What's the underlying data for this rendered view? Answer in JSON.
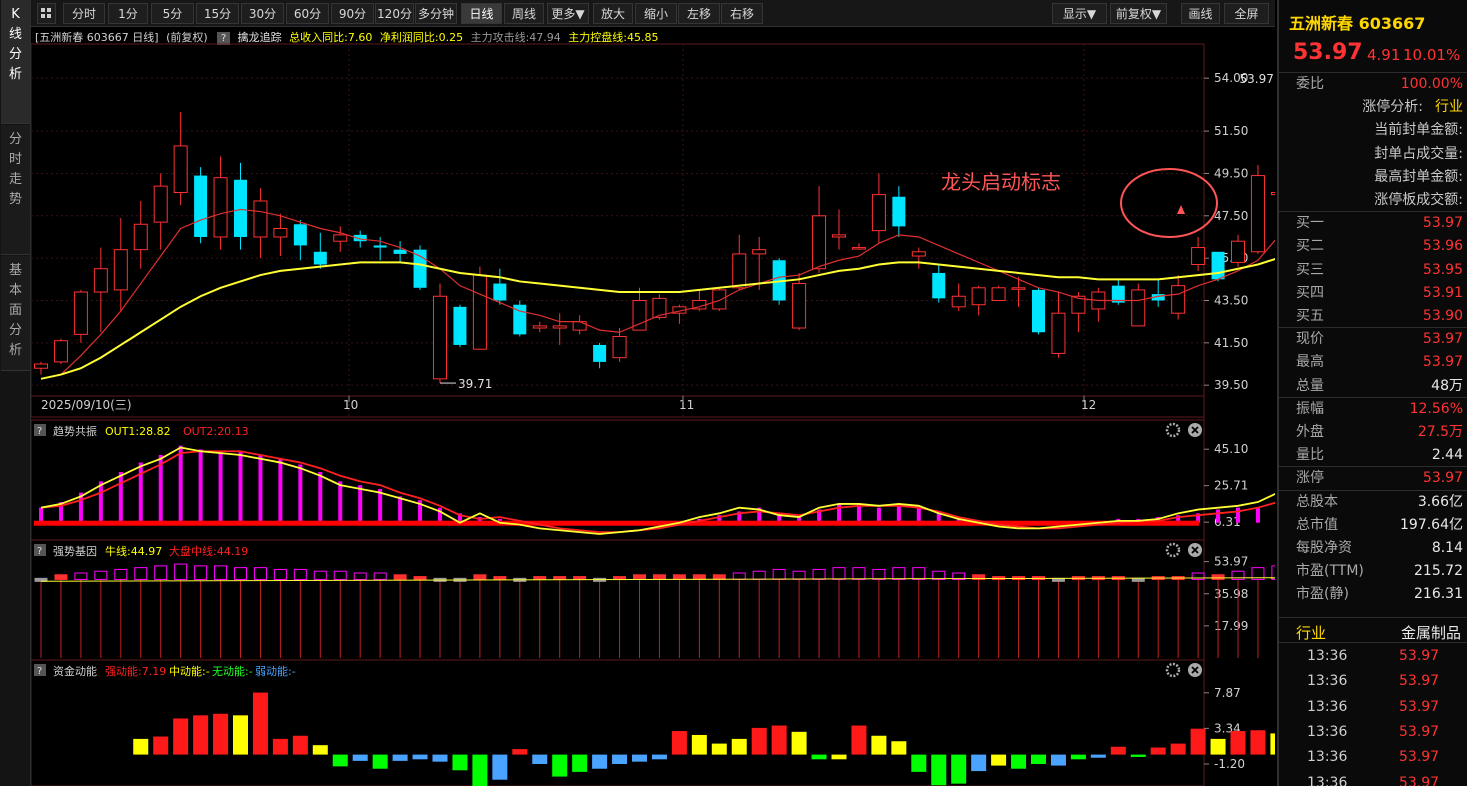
{
  "sidebar": {
    "tabs": [
      {
        "label": [
          "K",
          "线",
          "分",
          "析"
        ]
      },
      {
        "label": [
          "分",
          "时",
          "走",
          "势"
        ]
      },
      {
        "label": [
          "基",
          "本",
          "面",
          "分",
          "析"
        ]
      }
    ]
  },
  "toolbar": {
    "periods": [
      "分时",
      "1分",
      "5分",
      "15分",
      "30分",
      "60分",
      "90分",
      "120分",
      "多分钟",
      "日线",
      "周线",
      "更多▼"
    ],
    "selected": "日线",
    "actions": [
      "放大",
      "缩小",
      "左移",
      "右移"
    ],
    "right": [
      "显示▼",
      "前复权▼",
      "画线",
      "全屏"
    ]
  },
  "main_chart": {
    "header": {
      "stock": "[五洲新春 603667 日线]",
      "adjust": "(前复权)",
      "indicator": "擒龙追踪",
      "v1": "总收入同比:7.60",
      "v2": "净利润同比:0.25",
      "v3": "主力攻击线:47.94",
      "v4": "主力控盘线:45.85"
    },
    "annotation": "龙头启动标志",
    "high_label": "53.97",
    "low_label": "39.71",
    "date_labels": [
      "2025/09/10(三)",
      "10",
      "11",
      "12"
    ]
  },
  "chart_data": [
    {
      "type": "candlestick",
      "title": "[五洲新春 603667 日线]",
      "ylim": [
        38.8,
        55.0
      ],
      "yticks": [
        "54.00",
        "51.50",
        "49.50",
        "47.50",
        "45.50",
        "43.50",
        "41.50",
        "39.50"
      ],
      "candles": [
        [
          40.3,
          40.5,
          40.0,
          40.6
        ],
        [
          40.6,
          41.6,
          40.5,
          41.7
        ],
        [
          41.9,
          43.9,
          41.5,
          44.0
        ],
        [
          43.9,
          45.0,
          42.0,
          46.0
        ],
        [
          44.0,
          45.9,
          43.0,
          47.4
        ],
        [
          45.9,
          47.1,
          45.0,
          48.2
        ],
        [
          47.2,
          48.9,
          45.9,
          49.5
        ],
        [
          48.6,
          50.8,
          48.0,
          52.4
        ],
        [
          49.4,
          46.5,
          46.2,
          49.8
        ],
        [
          46.5,
          49.3,
          45.9,
          50.3
        ],
        [
          49.2,
          46.5,
          45.9,
          50.0
        ],
        [
          46.5,
          48.2,
          45.5,
          48.8
        ],
        [
          46.5,
          46.9,
          45.6,
          47.6
        ],
        [
          47.1,
          46.1,
          45.4,
          47.3
        ],
        [
          45.8,
          45.2,
          45.0,
          46.7
        ],
        [
          46.3,
          46.6,
          45.8,
          47.0
        ],
        [
          46.6,
          46.3,
          46.0,
          46.8
        ],
        [
          46.1,
          46.0,
          45.4,
          46.5
        ],
        [
          45.9,
          45.7,
          45.3,
          46.3
        ],
        [
          45.9,
          44.1,
          44.0,
          46.1
        ],
        [
          39.8,
          43.7,
          39.6,
          44.3
        ],
        [
          43.2,
          41.4,
          41.3,
          43.3
        ],
        [
          41.2,
          44.7,
          41.2,
          45.1
        ],
        [
          44.3,
          43.5,
          43.3,
          45.0
        ],
        [
          43.3,
          41.9,
          41.8,
          43.5
        ],
        [
          42.2,
          42.3,
          42.0,
          42.5
        ],
        [
          42.2,
          42.3,
          41.4,
          42.9
        ],
        [
          42.1,
          42.5,
          41.9,
          42.8
        ],
        [
          41.4,
          40.6,
          40.3,
          41.5
        ],
        [
          40.8,
          41.8,
          40.6,
          42.2
        ],
        [
          42.1,
          43.5,
          42.1,
          44.1
        ],
        [
          42.7,
          43.6,
          42.6,
          43.8
        ],
        [
          42.9,
          43.2,
          42.4,
          43.3
        ],
        [
          43.1,
          43.5,
          43.0,
          44.0
        ],
        [
          43.1,
          44.0,
          43.0,
          44.1
        ],
        [
          44.1,
          45.7,
          44.0,
          46.6
        ],
        [
          45.7,
          45.9,
          44.0,
          46.5
        ],
        [
          45.4,
          43.5,
          43.3,
          45.5
        ],
        [
          42.2,
          44.3,
          42.1,
          44.8
        ],
        [
          45.0,
          47.5,
          44.8,
          48.9
        ],
        [
          46.5,
          46.6,
          45.9,
          47.8
        ],
        [
          46.0,
          46.0,
          45.9,
          46.2
        ],
        [
          46.8,
          48.5,
          46.2,
          49.5
        ],
        [
          48.4,
          47.0,
          46.5,
          48.9
        ],
        [
          45.6,
          45.8,
          45.0,
          46.0
        ],
        [
          44.8,
          43.6,
          43.4,
          45.2
        ],
        [
          43.2,
          43.7,
          43.0,
          44.3
        ],
        [
          43.3,
          44.1,
          42.8,
          44.2
        ],
        [
          43.5,
          44.1,
          43.5,
          44.2
        ],
        [
          44.1,
          44.1,
          43.2,
          44.6
        ],
        [
          44.0,
          42.0,
          41.9,
          44.1
        ],
        [
          41.0,
          42.9,
          40.8,
          43.9
        ],
        [
          42.9,
          43.7,
          42.0,
          43.9
        ],
        [
          43.1,
          43.9,
          42.5,
          44.1
        ],
        [
          44.2,
          43.4,
          43.3,
          44.5
        ],
        [
          42.3,
          44.0,
          42.3,
          44.3
        ],
        [
          43.8,
          43.5,
          43.2,
          44.5
        ],
        [
          42.9,
          44.2,
          42.6,
          44.7
        ],
        [
          45.2,
          46.0,
          44.9,
          46.5
        ],
        [
          45.8,
          44.5,
          44.4,
          45.8
        ],
        [
          45.3,
          46.3,
          45.1,
          46.6
        ],
        [
          45.8,
          49.4,
          45.7,
          49.9
        ],
        [
          48.5,
          48.6,
          45.0,
          50.5
        ],
        [
          48.4,
          53.97,
          48.0,
          53.97
        ]
      ],
      "series": [
        {
          "name": "主力攻击线",
          "values": [
            39.8,
            40.0,
            40.9,
            41.9,
            43.0,
            44.3,
            45.6,
            46.9,
            47.3,
            47.6,
            47.8,
            47.7,
            47.5,
            47.2,
            46.9,
            46.7,
            46.4,
            46.3,
            46.0,
            45.6,
            45.0,
            44.2,
            43.8,
            43.4,
            43.0,
            42.8,
            42.5,
            42.5,
            42.1,
            42.0,
            42.4,
            42.8,
            43.0,
            43.2,
            43.5,
            44.0,
            44.3,
            44.6,
            44.7,
            45.1,
            45.4,
            45.6,
            46.2,
            46.6,
            46.5,
            46.1,
            45.7,
            45.3,
            44.9,
            44.5,
            44.1,
            43.9,
            43.6,
            43.5,
            43.5,
            43.5,
            43.7,
            43.8,
            44.2,
            44.5,
            44.9,
            45.4,
            46.5,
            47.94
          ]
        },
        {
          "name": "主力控盘线",
          "values": [
            39.8,
            40.0,
            40.3,
            40.8,
            41.4,
            42.0,
            42.6,
            43.2,
            43.7,
            44.1,
            44.4,
            44.7,
            44.9,
            45.0,
            45.1,
            45.2,
            45.3,
            45.3,
            45.3,
            45.2,
            45.0,
            44.8,
            44.7,
            44.6,
            44.4,
            44.3,
            44.2,
            44.1,
            44.0,
            43.9,
            43.9,
            43.9,
            43.9,
            44.0,
            44.1,
            44.2,
            44.3,
            44.4,
            44.5,
            44.7,
            44.9,
            45.0,
            45.2,
            45.3,
            45.3,
            45.2,
            45.1,
            45.0,
            44.9,
            44.8,
            44.7,
            44.6,
            44.6,
            44.5,
            44.5,
            44.5,
            44.5,
            44.6,
            44.7,
            44.8,
            45.0,
            45.2,
            45.5,
            45.85
          ]
        }
      ]
    },
    {
      "type": "bar",
      "title": "趋势共振",
      "legend": [
        "OUT1:28.82",
        "OUT2:20.13"
      ],
      "yticks": [
        "45.10",
        "25.71",
        "6.31"
      ],
      "ylim": [
        0,
        50
      ],
      "values": [
        14,
        17,
        22,
        28,
        33,
        38,
        42,
        47,
        45,
        44,
        44,
        42,
        40,
        37,
        33,
        28,
        26,
        24,
        20,
        18,
        14,
        11,
        9,
        8,
        7,
        5,
        3,
        2,
        1,
        1,
        2,
        4,
        6,
        8,
        10,
        12,
        14,
        11,
        10,
        13,
        16,
        16,
        14,
        16,
        14,
        12,
        9,
        7,
        5,
        4,
        4,
        5,
        6,
        7,
        8,
        8,
        9,
        10,
        11,
        13,
        14,
        14,
        18,
        32
      ],
      "series": [
        {
          "name": "OUT1",
          "values": [
            14,
            16,
            20,
            26,
            31,
            36,
            40,
            46,
            44,
            43,
            42,
            40,
            38,
            35,
            31,
            26,
            24,
            22,
            19,
            16,
            12,
            6,
            11,
            6,
            5,
            3,
            2,
            1,
            0,
            1,
            2,
            4,
            6,
            9,
            11,
            14,
            13,
            10,
            9,
            14,
            16,
            16,
            15,
            16,
            15,
            11,
            8,
            6,
            4,
            3,
            3,
            4,
            5,
            6,
            7,
            7,
            8,
            11,
            13,
            14,
            15,
            17,
            22,
            28.82
          ]
        },
        {
          "name": "OUT2",
          "values": [
            14,
            15,
            18,
            22,
            27,
            32,
            37,
            43,
            44,
            44,
            44,
            42,
            40,
            38,
            35,
            31,
            28,
            26,
            22,
            19,
            15,
            10,
            8,
            9,
            7,
            5,
            3,
            2,
            1,
            1,
            2,
            3,
            5,
            7,
            9,
            11,
            12,
            11,
            10,
            12,
            14,
            15,
            15,
            15,
            14,
            12,
            9,
            7,
            5,
            4,
            3,
            3,
            4,
            5,
            6,
            7,
            7,
            9,
            10,
            11,
            12,
            14,
            17,
            20.13
          ]
        }
      ]
    },
    {
      "type": "bar",
      "title": "强势基因",
      "legend": [
        "牛线:44.97",
        "大盘中线:44.19"
      ],
      "yticks": [
        "53.97",
        "35.98",
        "17.99"
      ],
      "ylim": [
        0,
        56
      ],
      "values": [
        44,
        46,
        47,
        48,
        49,
        50,
        51,
        52,
        51,
        51,
        50,
        50,
        49,
        49,
        48,
        48,
        47,
        47,
        46,
        45,
        43,
        44,
        46,
        45,
        44,
        45,
        45,
        45,
        44,
        45,
        46,
        46,
        46,
        46,
        46,
        47,
        48,
        49,
        48,
        49,
        50,
        50,
        49,
        50,
        50,
        48,
        47,
        46,
        45,
        45,
        45,
        44,
        45,
        45,
        45,
        44,
        45,
        45,
        47,
        46,
        48,
        50,
        51,
        53.97
      ]
    },
    {
      "type": "bar",
      "title": "资金动能",
      "legend": [
        "强动能:7.19",
        "中动能:-",
        "无动能:-",
        "弱动能:-"
      ],
      "yticks": [
        "7.87",
        "3.34",
        "-1.20"
      ],
      "ylim": [
        -4,
        9.5
      ],
      "values": [
        2.0,
        2.3,
        4.6,
        5.0,
        5.2,
        5.0,
        7.9,
        2.0,
        2.4,
        1.2,
        -1.5,
        -0.8,
        -1.8,
        -0.8,
        -0.6,
        -0.9,
        -2.0,
        -4.2,
        -3.2,
        0.7,
        -1.2,
        -2.8,
        -2.2,
        -1.8,
        -1.2,
        -0.9,
        -0.6,
        3.0,
        2.5,
        1.4,
        2.0,
        3.4,
        3.7,
        2.9,
        -0.6,
        -0.6,
        3.7,
        2.4,
        1.7,
        -2.2,
        -3.9,
        -3.7,
        -2.1,
        -1.4,
        -1.8,
        -1.2,
        -1.4,
        -0.6,
        -0.4,
        1.0,
        -0.3,
        0.9,
        1.4,
        3.3,
        2.0,
        3.0,
        3.1,
        2.7,
        7.19
      ],
      "color_codes": [
        "y",
        "r",
        "r",
        "r",
        "r",
        "y",
        "r",
        "r",
        "r",
        "y",
        "g",
        "b",
        "g",
        "b",
        "b",
        "b",
        "g",
        "g",
        "b",
        "r",
        "b",
        "g",
        "g",
        "b",
        "b",
        "b",
        "b",
        "r",
        "y",
        "y",
        "y",
        "r",
        "r",
        "y",
        "g",
        "y",
        "r",
        "y",
        "y",
        "g",
        "g",
        "g",
        "b",
        "y",
        "g",
        "g",
        "b",
        "g",
        "b",
        "r",
        "g",
        "r",
        "r",
        "r",
        "y",
        "r",
        "r",
        "y",
        "r"
      ]
    }
  ],
  "panel_headers": [
    {
      "name": "趋势共振",
      "items": [
        {
          "t": "OUT1:28.82",
          "c": "#ffff00"
        },
        {
          "t": "OUT2:20.13",
          "c": "#ff2020"
        }
      ]
    },
    {
      "name": "强势基因",
      "items": [
        {
          "t": "牛线:44.97",
          "c": "#ffff00"
        },
        {
          "t": "大盘中线:44.19",
          "c": "#ff2020"
        }
      ]
    },
    {
      "name": "资金动能",
      "items": [
        {
          "t": "强动能:7.19",
          "c": "#ff2020"
        },
        {
          "t": "中动能:-",
          "c": "#ffff00"
        },
        {
          "t": "无动能:-",
          "c": "#22ff22"
        },
        {
          "t": "弱动能:-",
          "c": "#4aa3ff"
        }
      ]
    }
  ],
  "quote": {
    "name_code": "五洲新春 603667",
    "price": "53.97",
    "change": "4.91",
    "pct": "10.01%",
    "rows": [
      {
        "k": "委比",
        "v": "100.00%",
        "c": "red"
      },
      {
        "k": "涨停分析:",
        "v": "行业",
        "c": "yellow",
        "indent": true
      },
      {
        "k": "当前封单金额:",
        "v": "",
        "c": "white",
        "indent": true
      },
      {
        "k": "封单占成交量:",
        "v": "",
        "c": "white",
        "indent": true
      },
      {
        "k": "最高封单金额:",
        "v": "",
        "c": "white",
        "indent": true
      },
      {
        "k": "涨停板成交额:",
        "v": "",
        "c": "white",
        "indent": true
      },
      {
        "k": "买一",
        "v": "53.97",
        "c": "red"
      },
      {
        "k": "买二",
        "v": "53.96",
        "c": "red"
      },
      {
        "k": "买三",
        "v": "53.95",
        "c": "red"
      },
      {
        "k": "买四",
        "v": "53.91",
        "c": "red"
      },
      {
        "k": "买五",
        "v": "53.90",
        "c": "red"
      },
      {
        "k": "现价",
        "v": "53.97",
        "c": "red"
      },
      {
        "k": "最高",
        "v": "53.97",
        "c": "red"
      },
      {
        "k": "总量",
        "v": "48万",
        "c": "white"
      },
      {
        "k": "振幅",
        "v": "12.56%",
        "c": "red"
      },
      {
        "k": "外盘",
        "v": "27.5万",
        "c": "red"
      },
      {
        "k": "量比",
        "v": "2.44",
        "c": "white"
      },
      {
        "k": "涨停",
        "v": "53.97",
        "c": "red"
      },
      {
        "k": "总股本",
        "v": "3.66亿",
        "c": "white"
      },
      {
        "k": "总市值",
        "v": "197.64亿",
        "c": "white"
      },
      {
        "k": "每股净资",
        "v": "8.14",
        "c": "white"
      },
      {
        "k": "市盈(TTM)",
        "v": "215.72",
        "c": "white"
      },
      {
        "k": "市盈(静)",
        "v": "216.31",
        "c": "white"
      }
    ],
    "industry_label": "行业",
    "industry_value": "金属制品",
    "ticks": [
      {
        "t": "13:36",
        "p": "53.97"
      },
      {
        "t": "13:36",
        "p": "53.97"
      },
      {
        "t": "13:36",
        "p": "53.97"
      },
      {
        "t": "13:36",
        "p": "53.97"
      },
      {
        "t": "13:36",
        "p": "53.97"
      },
      {
        "t": "13:36",
        "p": "53.97"
      }
    ]
  },
  "colors": {
    "up": "#ff3232",
    "down": "#00e5ff",
    "yellow": "#ffff00",
    "magenta": "#ff00ff",
    "grid": "#3a1414"
  }
}
